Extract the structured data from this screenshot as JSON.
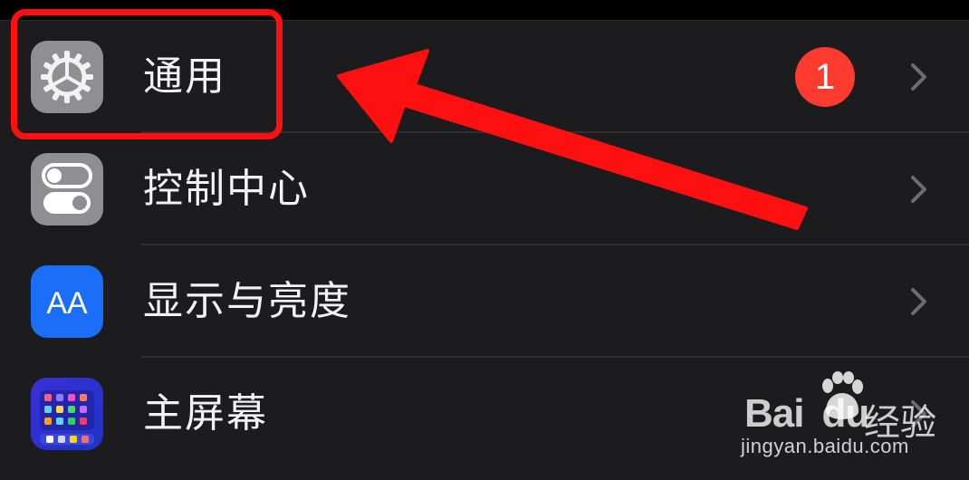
{
  "settings": {
    "items": [
      {
        "label": "通用",
        "icon": "gear-icon",
        "badge": "1"
      },
      {
        "label": "控制中心",
        "icon": "toggle-switches-icon"
      },
      {
        "label": "显示与亮度",
        "icon": "text-size-aa-icon",
        "icon_text": "AA"
      },
      {
        "label": "主屏幕",
        "icon": "home-screen-grid-icon"
      }
    ]
  },
  "watermark": {
    "brand": "Bai",
    "brand_du": "du",
    "product": "经验",
    "url": "jingyan.baidu.com"
  },
  "colors": {
    "background": "#000000",
    "group_background": "#1c1c1e",
    "text": "#f2f2f7",
    "badge": "#ff3b30",
    "annotation": "#ff1010",
    "display_icon": "#1a6ef7",
    "gray_icon": "#8e8e93"
  }
}
